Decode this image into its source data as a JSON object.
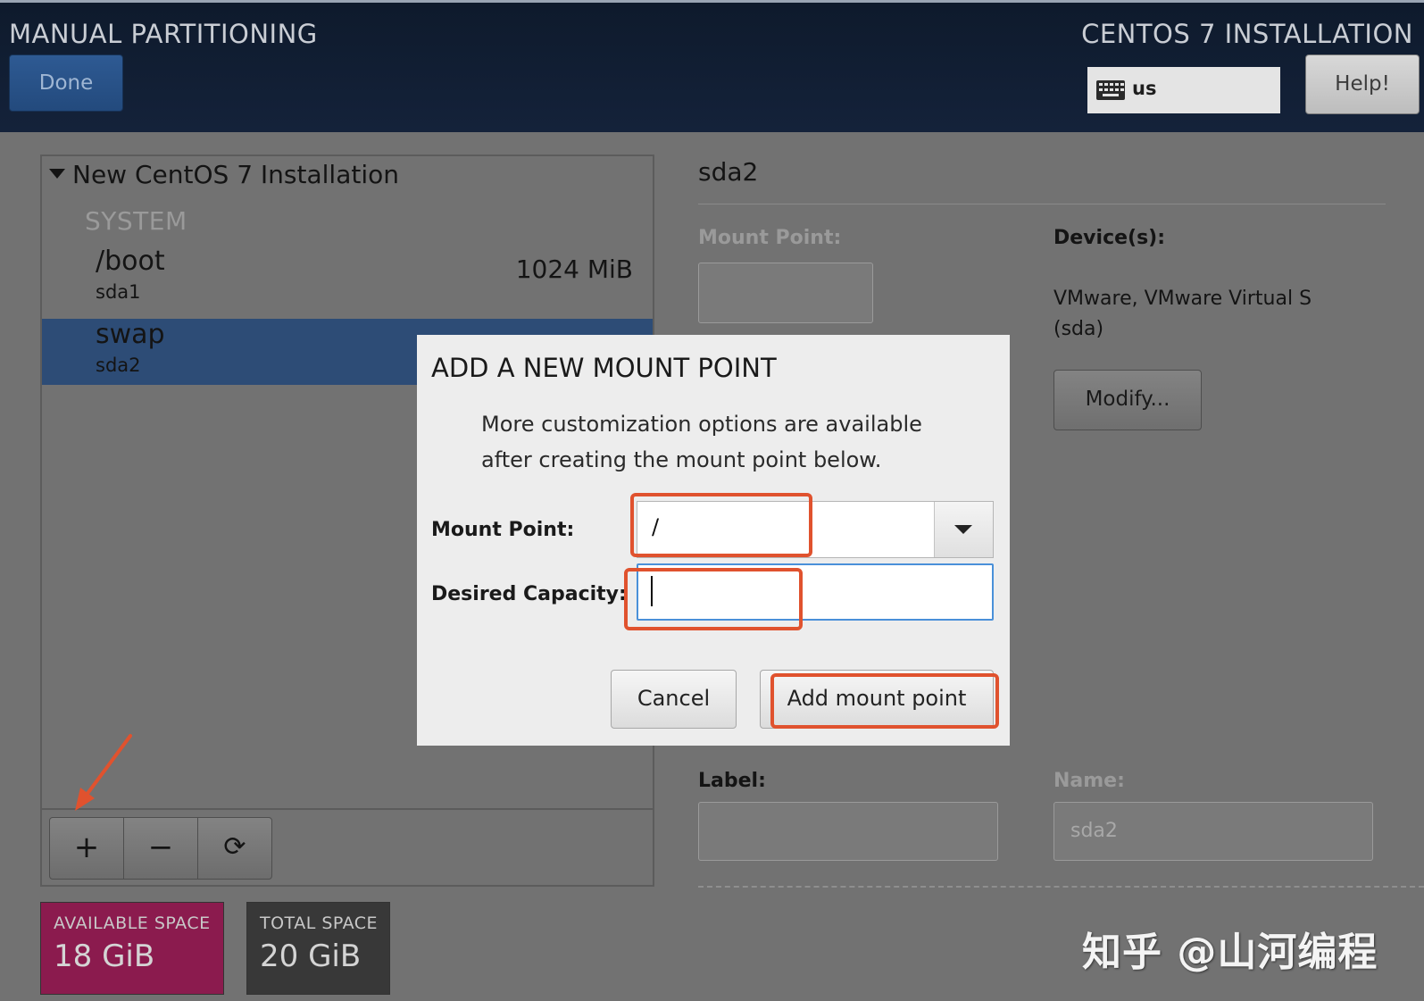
{
  "header": {
    "spoke_title": "MANUAL PARTITIONING",
    "done_label": "Done",
    "product_title": "CENTOS 7 INSTALLATION",
    "keyboard_layout": "us",
    "help_label": "Help!"
  },
  "left_pane": {
    "installation_title": "New CentOS 7 Installation",
    "section_label": "SYSTEM",
    "partitions": [
      {
        "mount": "/boot",
        "device": "sda1",
        "size": "1024 MiB",
        "selected": false
      },
      {
        "mount": "swap",
        "device": "sda2",
        "size": "",
        "selected": true
      }
    ],
    "toolbar": {
      "add": "+",
      "remove": "−",
      "refresh": "⟳"
    }
  },
  "space": {
    "available_label": "AVAILABLE SPACE",
    "available_value": "18 GiB",
    "total_label": "TOTAL SPACE",
    "total_value": "20 GiB"
  },
  "right_pane": {
    "device_title": "sda2",
    "mount_point_label": "Mount Point:",
    "mount_point_value": "",
    "devices_label": "Device(s):",
    "devices_text_line1": "VMware, VMware Virtual S",
    "devices_text_line2": "(sda)",
    "modify_label": "Modify...",
    "label_label": "Label:",
    "label_value": "",
    "name_label": "Name:",
    "name_value": "sda2"
  },
  "dialog": {
    "title": "ADD A NEW MOUNT POINT",
    "desc_line1": "More customization options are available",
    "desc_line2": "after creating the mount point below.",
    "mount_point_label": "Mount Point:",
    "mount_point_value": "/",
    "capacity_label": "Desired Capacity:",
    "capacity_value": "",
    "cancel_label": "Cancel",
    "add_label": "Add mount point"
  },
  "watermark": "知乎 @山河编程",
  "colors": {
    "header_bg": "#14223a",
    "selected_row": "#2d4c76",
    "available_space": "#8b1b4e",
    "annotation": "#e0522e",
    "focus_border": "#4a90d9"
  }
}
